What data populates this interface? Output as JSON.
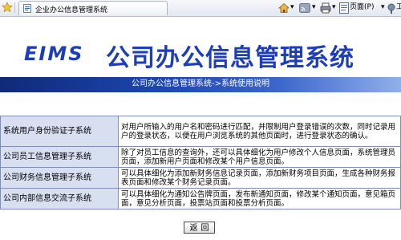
{
  "browser": {
    "tab_title": "企业办公信息管理系统",
    "page_menu": "页面(P)",
    "tools_menu": "工"
  },
  "header": {
    "logo": "EIMS",
    "title": "公司办公信息管理系统",
    "breadcrumb": "公司办公信息管理系统->系统使用说明"
  },
  "modules": [
    {
      "name": "系统用户身份验证子系统",
      "desc": "对用户所输入的用户名和密码进行匹配，并限制用户登录错误的次数，同时记录用户的登录状态，以便在用户浏览系统的其他页面时，进行登录状态的确认。"
    },
    {
      "name": "公司员工信息管理子系统",
      "desc": "除了对员工信息的查询外，还可以具体细化为用户修改个人信息页面，系统管理员页面，添加新用户页面和修改某个用户信息页面。"
    },
    {
      "name": "公司财务信息管理子系统",
      "desc": "可以具体细化为添加新财务信息记录页面，添加新财务项目页面，生成各种财务报表页面和修改某个财务记录页面。"
    },
    {
      "name": "公司内部信息交流子系统",
      "desc": "可以具体细化为通知公告牌页面，发布新通知页面，修改某个通知页面，意见箱页面，意见分析页面，投票站页面和投票分析页面。"
    }
  ],
  "back_button": "返回",
  "colors": {
    "accent": "#1e3db8",
    "row_header_bg": "#d8dff1",
    "bar_dark": "#0f2a78"
  }
}
